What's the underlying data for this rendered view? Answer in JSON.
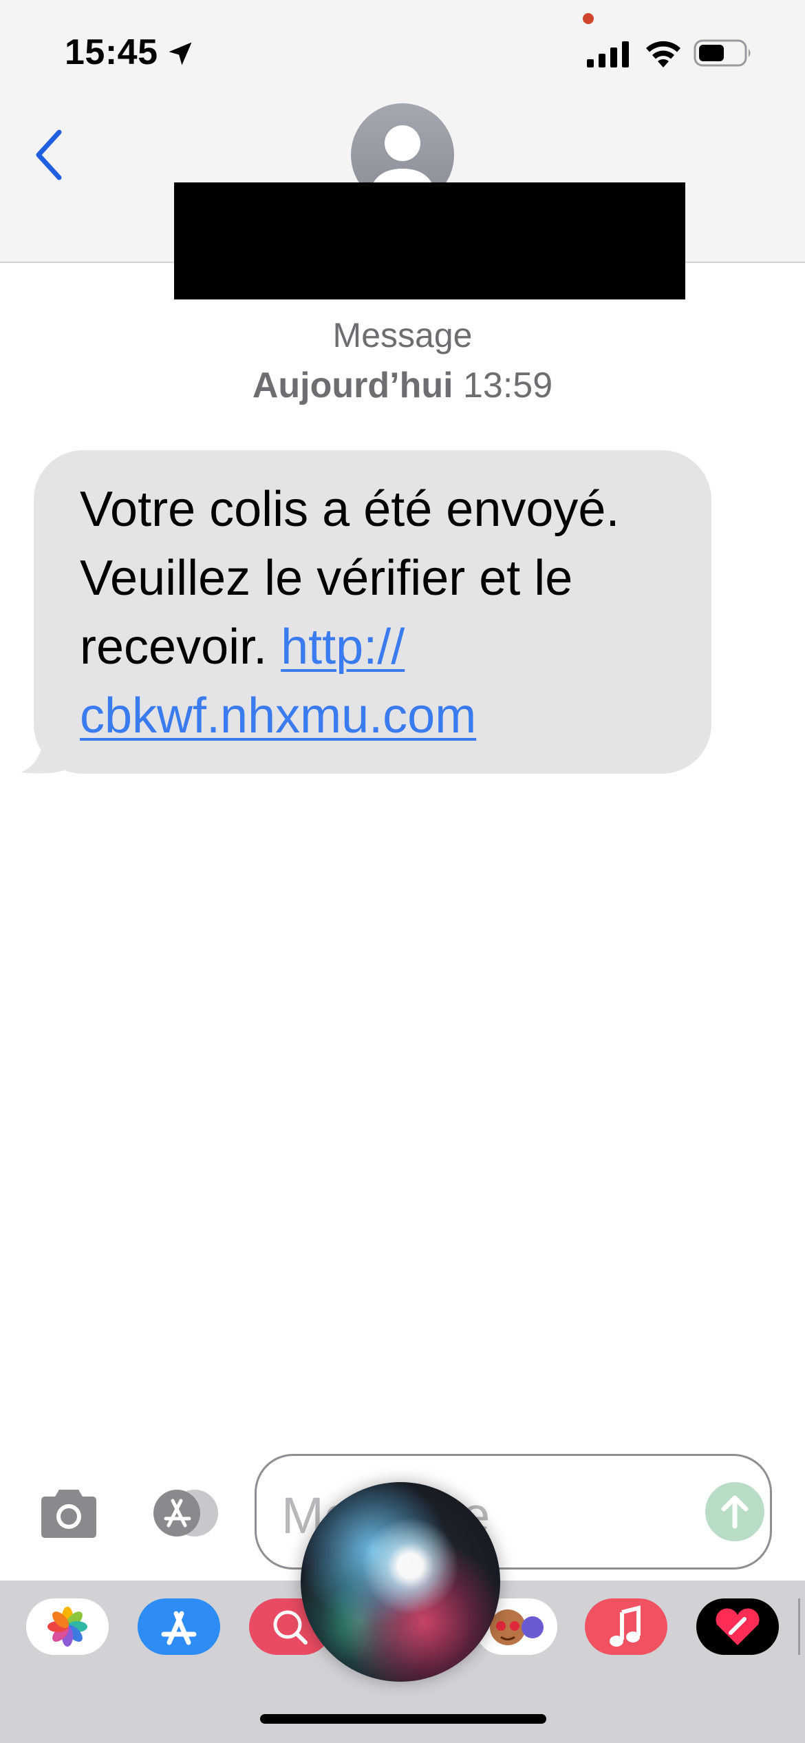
{
  "status_bar": {
    "time": "15:45",
    "location_icon": "location-arrow-icon",
    "signal_icon": "cellular-signal-icon",
    "wifi_icon": "wifi-icon",
    "battery_icon": "battery-icon",
    "battery_level": 0.55,
    "recording_dot_color": "#d0452c"
  },
  "header": {
    "back_icon": "chevron-left-icon",
    "avatar_icon": "person-avatar-icon",
    "accent_color": "#2060e0"
  },
  "thread": {
    "service_label": "Message",
    "date_day": "Aujourd’hui",
    "date_time": "13:59"
  },
  "message": {
    "text_before_link": "Votre colis a été envoyé. Veuillez le vérifier et le recevoir. ",
    "link_line1": "http://",
    "link_line2": "cbkwf.nhxmu.com",
    "bubble_color": "#e4e4e6",
    "link_color": "#3a7bf0"
  },
  "composer": {
    "camera_icon": "camera-icon",
    "apps_icon": "app-store-icon",
    "placeholder": "Message",
    "send_icon": "arrow-up-icon",
    "send_color": "#b9dcc4"
  },
  "app_tray": {
    "apps": [
      {
        "name": "photos-app-icon"
      },
      {
        "name": "app-store-app-icon"
      },
      {
        "name": "web-search-app-icon"
      },
      {
        "name": "memoji-app-icon"
      },
      {
        "name": "music-app-icon"
      },
      {
        "name": "fitness-app-icon"
      }
    ]
  },
  "overlay": {
    "siri_icon": "siri-orb-icon"
  }
}
